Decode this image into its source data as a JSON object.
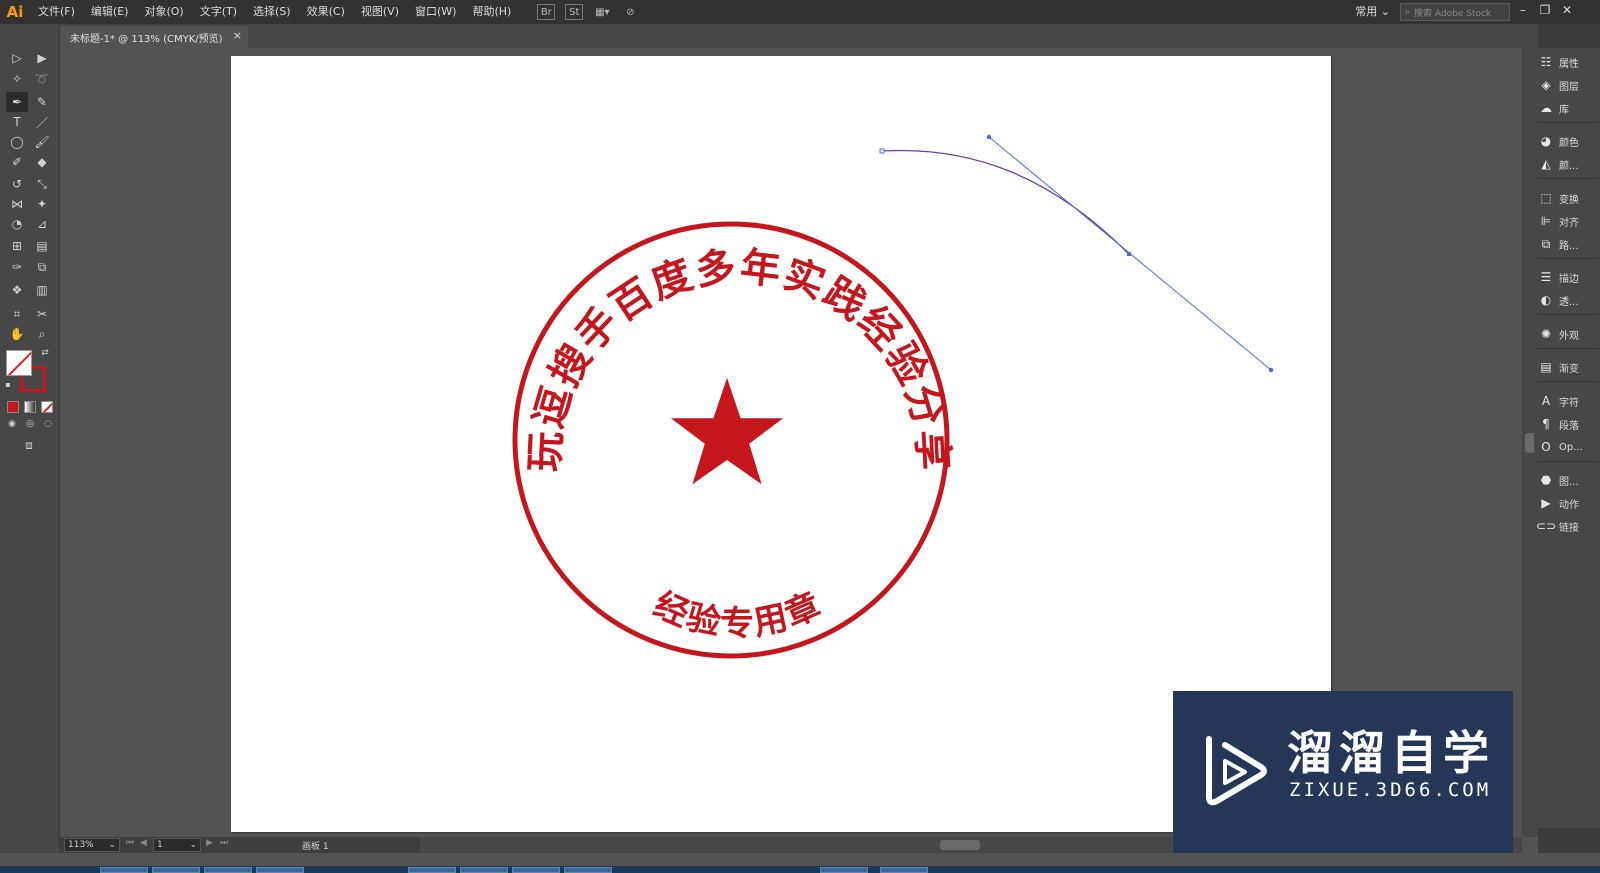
{
  "app": {
    "logo": "Ai",
    "workspace": "常用",
    "search_placeholder": "搜索 Adobe Stock"
  },
  "menu": [
    "文件(F)",
    "编辑(E)",
    "对象(O)",
    "文字(T)",
    "选择(S)",
    "效果(C)",
    "视图(V)",
    "窗口(W)",
    "帮助(H)"
  ],
  "menubar_icons": {
    "br": "Br",
    "st": "St"
  },
  "document": {
    "tab_title": "未标题-1* @ 113% (CMYK/预览)",
    "close": "×"
  },
  "status": {
    "zoom": "113%",
    "page": "1",
    "artboard_label": "画板 1"
  },
  "panels": [
    {
      "label": "属性",
      "icon": "properties-icon"
    },
    {
      "label": "图层",
      "icon": "layers-icon"
    },
    {
      "label": "库",
      "icon": "libraries-icon"
    },
    {
      "label": "颜色",
      "icon": "color-icon"
    },
    {
      "label": "颜...",
      "icon": "color-guide-icon"
    },
    {
      "label": "变换",
      "icon": "transform-icon"
    },
    {
      "label": "对齐",
      "icon": "align-icon"
    },
    {
      "label": "路...",
      "icon": "pathfinder-icon"
    },
    {
      "label": "描边",
      "icon": "stroke-icon"
    },
    {
      "label": "透...",
      "icon": "transparency-icon"
    },
    {
      "label": "外观",
      "icon": "appearance-icon"
    },
    {
      "label": "渐变",
      "icon": "gradient-icon"
    },
    {
      "label": "字符",
      "icon": "character-icon"
    },
    {
      "label": "段落",
      "icon": "paragraph-icon"
    },
    {
      "label": "Op...",
      "icon": "opentype-icon"
    },
    {
      "label": "图...",
      "icon": "graphic-styles-icon"
    },
    {
      "label": "动作",
      "icon": "actions-icon"
    },
    {
      "label": "链接",
      "icon": "links-icon"
    }
  ],
  "artwork": {
    "seal_arc_text": "玩逗搜手百度多年实践经验分享",
    "seal_bottom_text": "经验专用章",
    "seal_color": "#c4161c",
    "path_color": "#4a5fd4"
  },
  "watermark": {
    "title": "溜溜自学",
    "subtitle": "ZIXUE.3D66.COM",
    "bg": "#243759"
  }
}
